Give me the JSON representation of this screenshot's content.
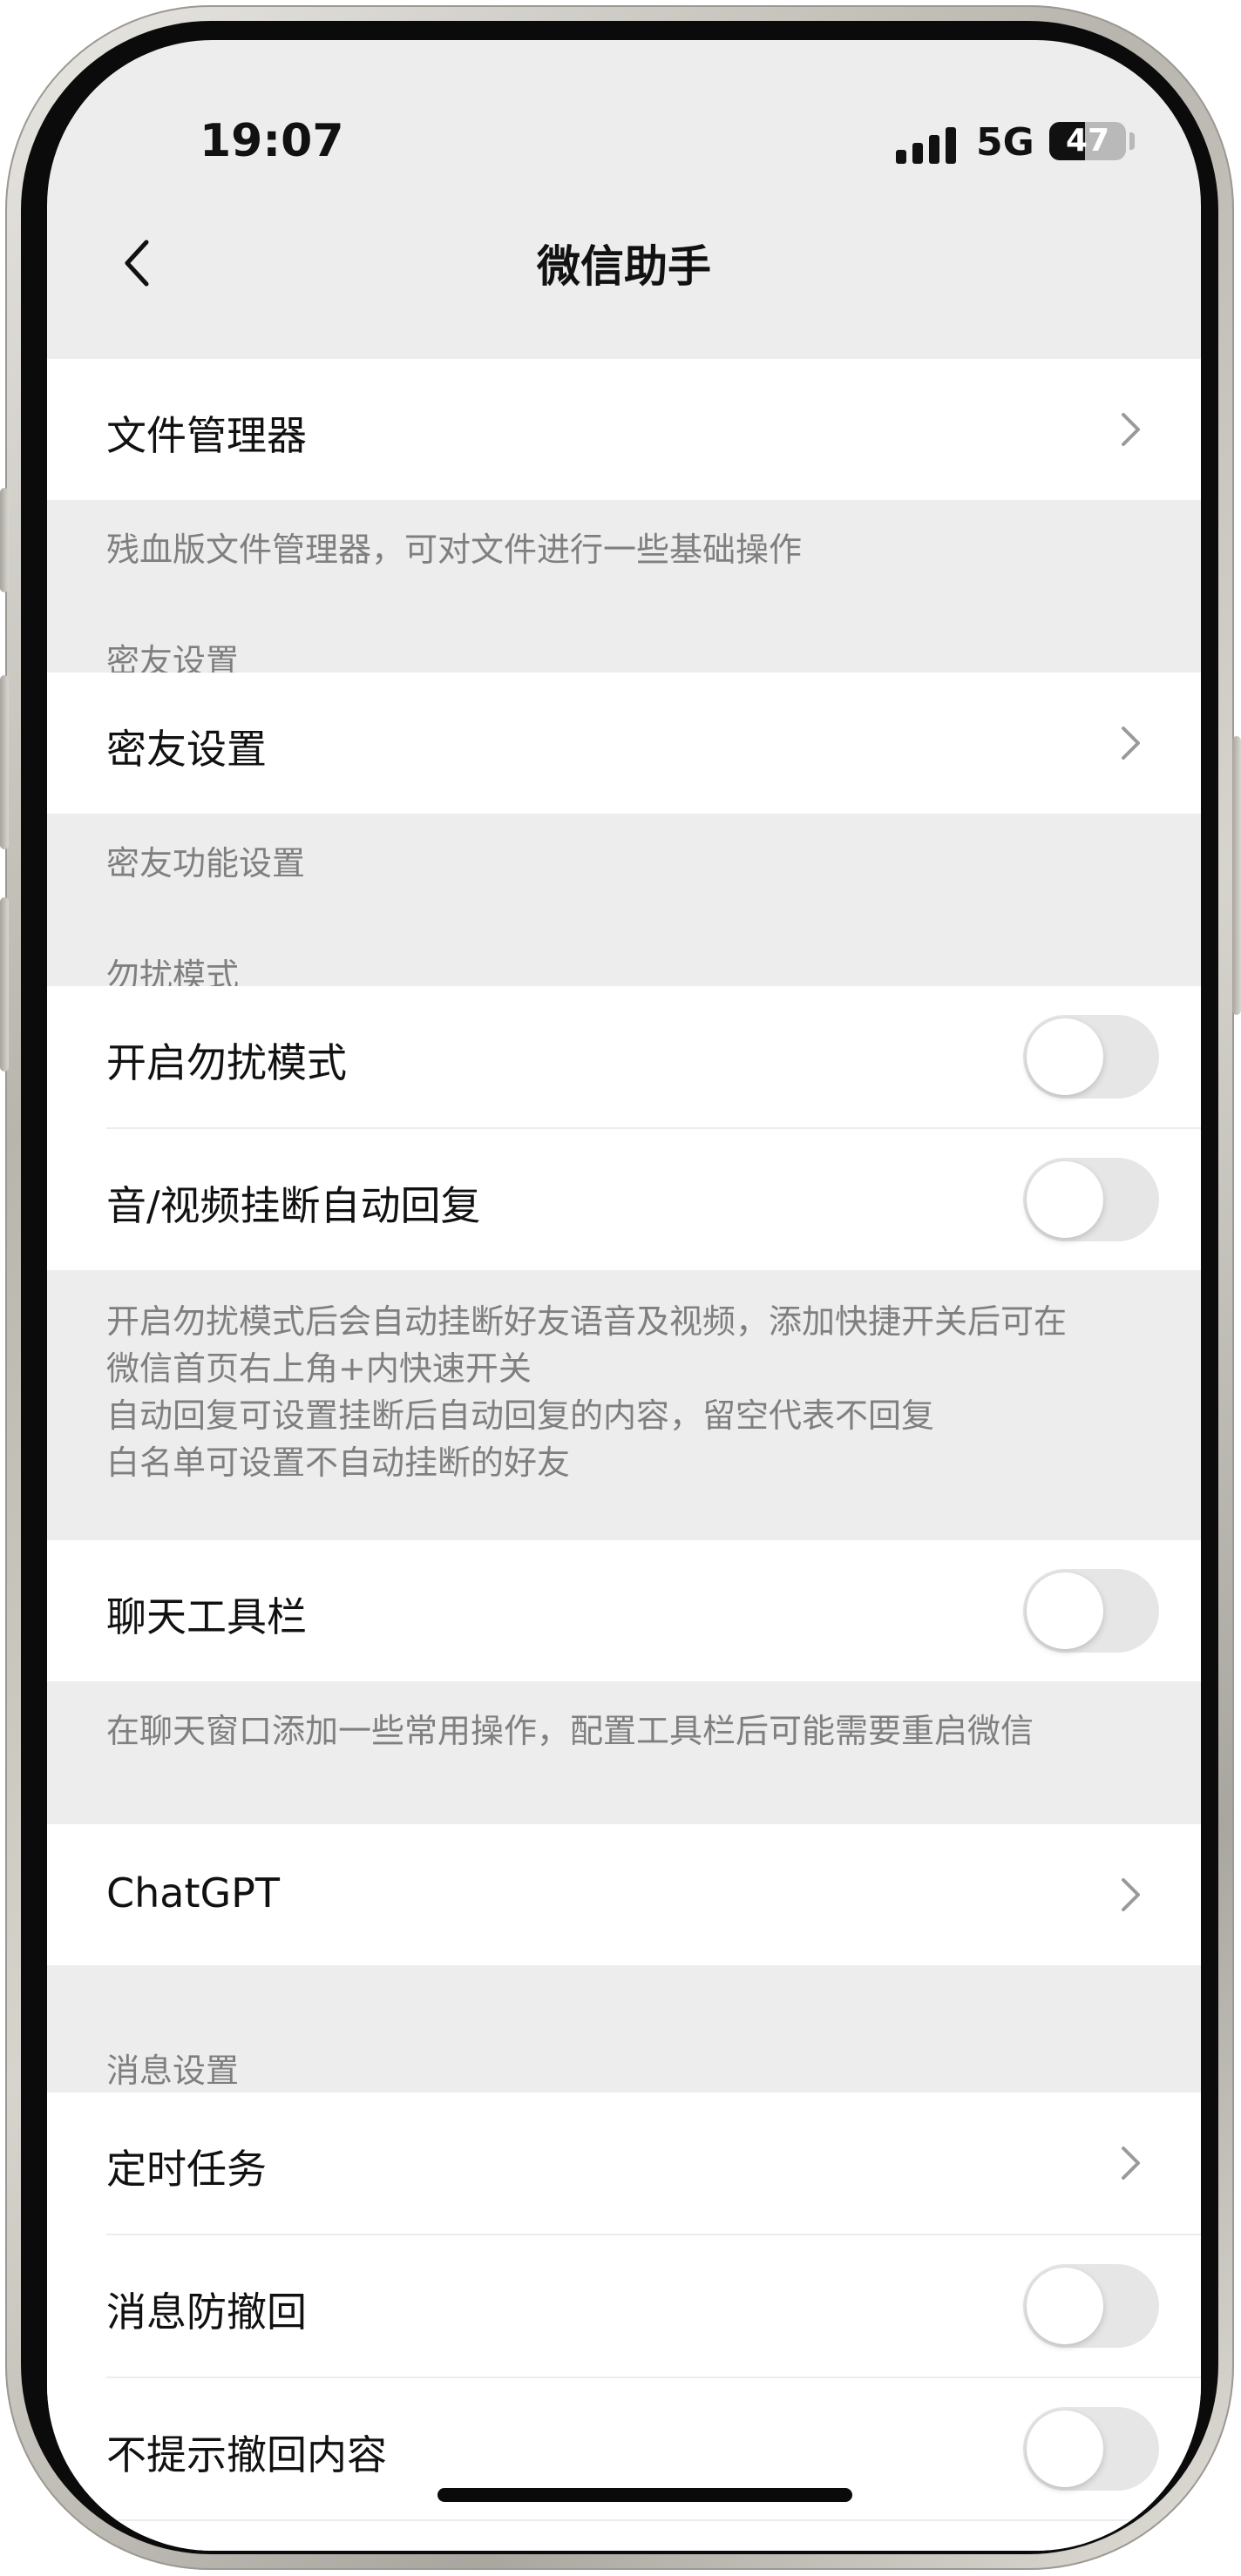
{
  "status": {
    "time": "19:07",
    "network": "5G",
    "battery": "47",
    "battery_level": 0.47
  },
  "nav": {
    "title": "微信助手"
  },
  "file_manager": {
    "label": "文件管理器",
    "note": "残血版文件管理器，可对文件进行一些基础操作"
  },
  "close_friends": {
    "section": "密友设置",
    "label": "密友设置",
    "note": "密友功能设置"
  },
  "dnd": {
    "section": "勿扰模式",
    "enable_label": "开启勿扰模式",
    "enable_on": false,
    "auto_reply_label": "音/视频挂断自动回复",
    "auto_reply_on": false,
    "note_lines": [
      "开启勿扰模式后会自动挂断好友语音及视频，添加快捷开关后可在",
      "微信首页右上角+内快速开关",
      "自动回复可设置挂断后自动回复的内容，留空代表不回复",
      "白名单可设置不自动挂断的好友"
    ]
  },
  "toolbar": {
    "label": "聊天工具栏",
    "on": false,
    "note": "在聊天窗口添加一些常用操作，配置工具栏后可能需要重启微信"
  },
  "chatgpt": {
    "label": "ChatGPT"
  },
  "messages": {
    "section": "消息设置",
    "scheduled_label": "定时任务",
    "anti_recall_label": "消息防撤回",
    "anti_recall_on": false,
    "hide_recall_label": "不提示撤回内容",
    "hide_recall_on": false
  },
  "colors": {
    "background": "#ededed",
    "cell": "#ffffff",
    "toggle_off": "#e6e6e6",
    "note_text": "#7f7f7f"
  }
}
